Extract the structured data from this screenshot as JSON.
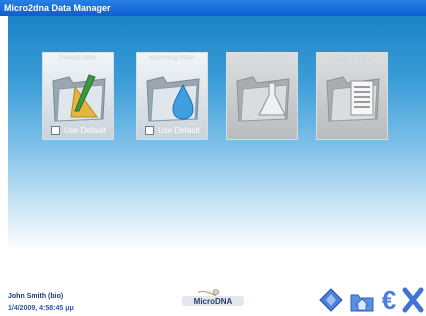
{
  "window": {
    "title": "Micro2dna Data Manager"
  },
  "cards": [
    {
      "title": "Protocol Editor",
      "icon": "folder-ruler-pencil-icon",
      "checkbox_label": "Use Default",
      "enabled": true
    },
    {
      "title": "Micro-array Editor",
      "icon": "folder-drop-icon",
      "checkbox_label": "Use Default",
      "enabled": true
    },
    {
      "title": "Execute Experiment",
      "icon": "folder-flask-icon",
      "enabled": false
    },
    {
      "title": "Results Analysis",
      "icon": "folder-report-icon",
      "enabled": false
    }
  ],
  "status": {
    "user": "John Smith (bio)",
    "datetime": "1/4/2009, 4:58:45 μμ"
  },
  "logo": {
    "text": "MicroDNA"
  },
  "toolbar": [
    "diamond-icon",
    "home-folder-icon",
    "euro-icon",
    "close-x-icon"
  ],
  "colors": {
    "accent": "#2f6fd8",
    "background_top": "#1b84c6"
  }
}
